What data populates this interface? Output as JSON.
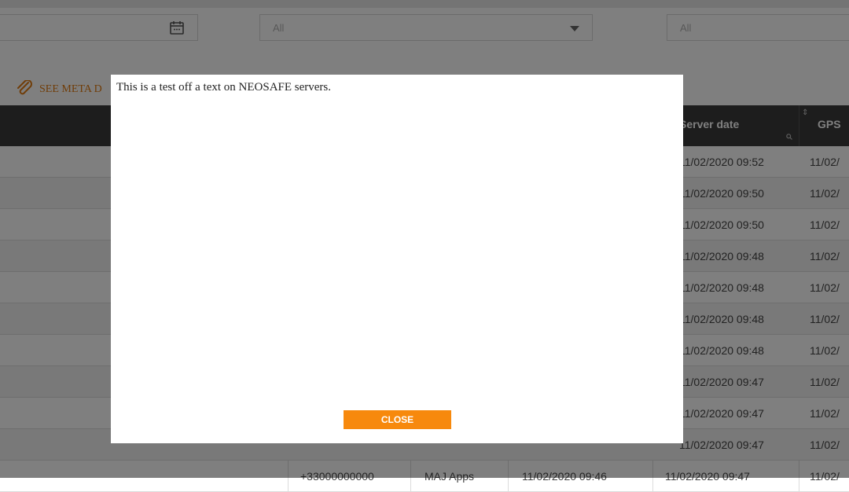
{
  "filters": {
    "select_primary_value": "All",
    "select_secondary_value": "All"
  },
  "meta_link_label": "SEE META D",
  "table": {
    "headers": {
      "server_date": "Server date",
      "gps": "GPS"
    },
    "rows": [
      {
        "server_date": "11/02/2020 09:52",
        "gps": "11/02/"
      },
      {
        "server_date": "11/02/2020 09:50",
        "gps": "11/02/"
      },
      {
        "server_date": "11/02/2020 09:50",
        "gps": "11/02/"
      },
      {
        "server_date": "11/02/2020 09:48",
        "gps": "11/02/"
      },
      {
        "server_date": "11/02/2020 09:48",
        "gps": "11/02/"
      },
      {
        "server_date": "11/02/2020 09:48",
        "gps": "11/02/"
      },
      {
        "server_date": "11/02/2020 09:48",
        "gps": "11/02/"
      },
      {
        "server_date": "11/02/2020 09:47",
        "gps": "11/02/"
      },
      {
        "server_date": "11/02/2020 09:47",
        "gps": "11/02/"
      },
      {
        "server_date": "11/02/2020 09:47",
        "gps": "11/02/"
      },
      {
        "phone": "+33000000000",
        "app": "MAJ Apps",
        "date": "11/02/2020 09:46",
        "server_date": "11/02/2020 09:47",
        "gps": "11/02/"
      }
    ]
  },
  "modal": {
    "message": "This is a test off a text on NEOSAFE servers.",
    "close_label": "CLOSE"
  },
  "colors": {
    "accent": "#f7890d",
    "header_bg": "#3b3b3b",
    "link": "#e07a10"
  }
}
